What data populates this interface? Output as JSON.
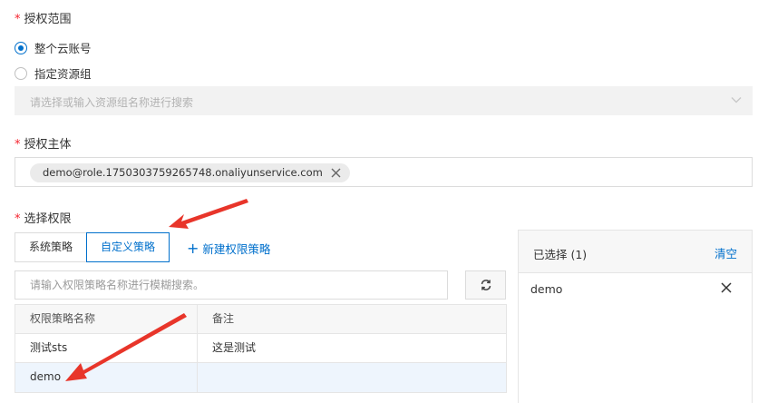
{
  "scope": {
    "label": "授权范围",
    "required_mark": "*",
    "options": [
      {
        "label": "整个云账号",
        "checked": true
      },
      {
        "label": "指定资源组",
        "checked": false
      }
    ],
    "resource_group_placeholder": "请选择或输入资源组名称进行搜索"
  },
  "principal": {
    "label": "授权主体",
    "required_mark": "*",
    "tag": "demo@role.1750303759265748.onaliyunservice.com"
  },
  "permissions": {
    "label": "选择权限",
    "required_mark": "*",
    "tabs": [
      "系统策略",
      "自定义策略"
    ],
    "active_tab": "自定义策略",
    "new_policy": "新建权限策略",
    "search_placeholder": "请输入权限策略名称进行模糊搜索。",
    "table": {
      "columns": [
        "权限策略名称",
        "备注"
      ],
      "rows": [
        {
          "name": "测试sts",
          "note": "这是测试"
        },
        {
          "name": "demo",
          "note": ""
        }
      ]
    }
  },
  "selected": {
    "title": "已选择 (1)",
    "clear": "清空",
    "items": [
      "demo"
    ]
  },
  "colors": {
    "accent": "#0070cc",
    "required": "#f5222d",
    "annotation_arrow": "#e8352a"
  }
}
